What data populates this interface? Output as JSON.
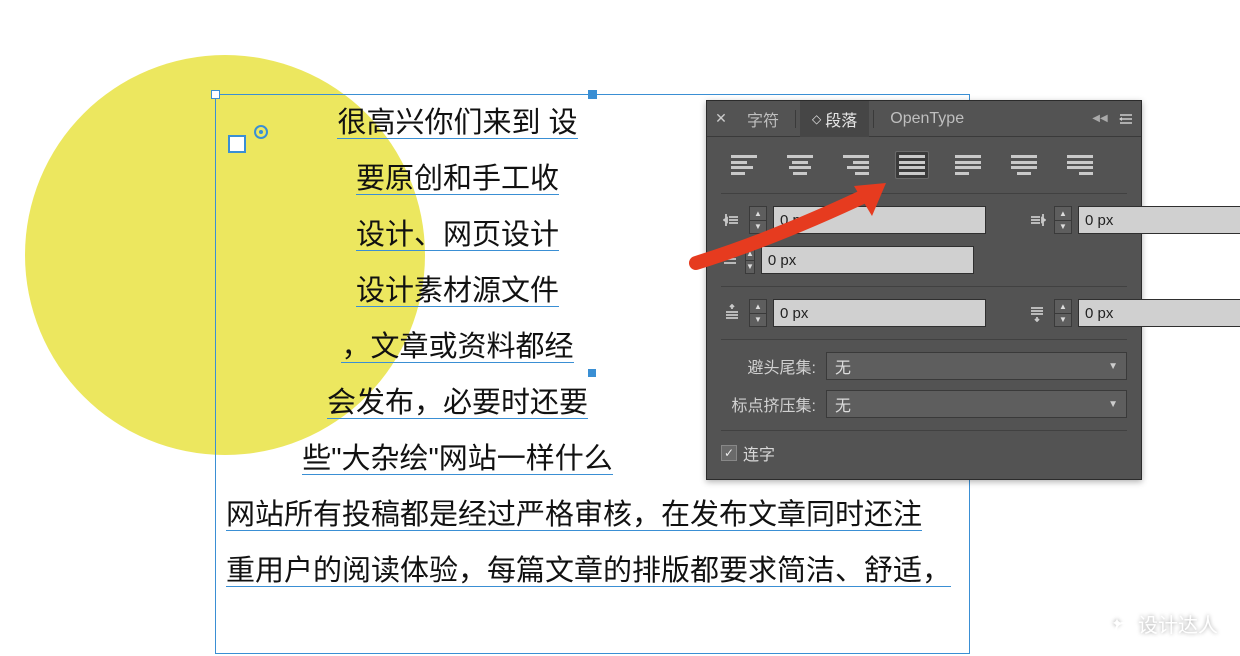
{
  "canvas": {
    "lines": [
      "很高兴你们来到 设",
      "要原创和手工收",
      "设计、网页设计",
      "设计素材源文件",
      "，文章或资料都经",
      "会发布，必要时还要",
      "些\"大杂绘\"网站一样什么",
      "网站所有投稿都是经过严格审核，在发布文章同时还注",
      "重用户的阅读体验，每篇文章的排版都要求简洁、舒适，"
    ]
  },
  "panel": {
    "tabs": {
      "char": "字符",
      "para": "段落",
      "opentype": "OpenType"
    },
    "indent": {
      "left": "0 px",
      "right": "0 px",
      "firstline": "0 px",
      "space_before": "0 px",
      "space_after": "0 px"
    },
    "kinsoku": {
      "label": "避头尾集:",
      "value": "无"
    },
    "mojikumi": {
      "label": "标点挤压集:",
      "value": "无"
    },
    "hyphenate": {
      "label": "连字",
      "checked": true
    }
  },
  "watermark": {
    "text": "设计达人"
  }
}
